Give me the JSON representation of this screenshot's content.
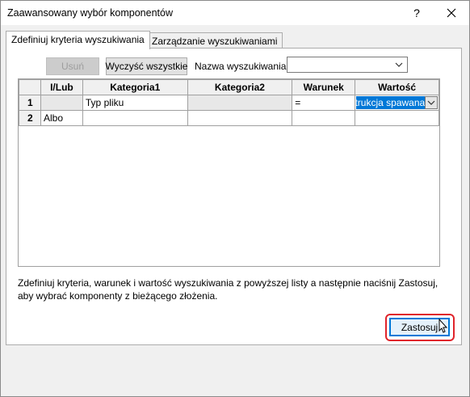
{
  "window": {
    "title": "Zaawansowany wybór komponentów"
  },
  "titlebar": {
    "help_label": "?"
  },
  "tabs": [
    {
      "label": "Zdefiniuj kryteria wyszukiwania",
      "active": true
    },
    {
      "label": "Zarządzanie wyszukiwaniami",
      "active": false
    }
  ],
  "toolbar": {
    "delete_label": "Usuń",
    "clear_all_label": "Wyczyść wszystkie",
    "search_name_label": "Nazwa wyszukiwania:",
    "search_name_value": ""
  },
  "grid": {
    "headers": [
      "I/Lub",
      "Kategoria1",
      "Kategoria2",
      "Warunek",
      "Wartość"
    ],
    "rows": [
      {
        "num": "1",
        "andor": "",
        "cat1": "Typ pliku",
        "cat2": "",
        "cond": "=",
        "value": "trukcja spawana"
      },
      {
        "num": "2",
        "andor": "Albo",
        "cat1": "",
        "cat2": "",
        "cond": "",
        "value": ""
      }
    ]
  },
  "info_text": "Zdefiniuj kryteria, warunek i wartość wyszukiwania z powyższej listy a następnie naciśnij Zastosuj, aby wybrać komponenty z bieżącego złożenia.",
  "apply_label": "Zastosuj",
  "colors": {
    "accent": "#0078d7",
    "highlight_ring": "#e0242b"
  }
}
